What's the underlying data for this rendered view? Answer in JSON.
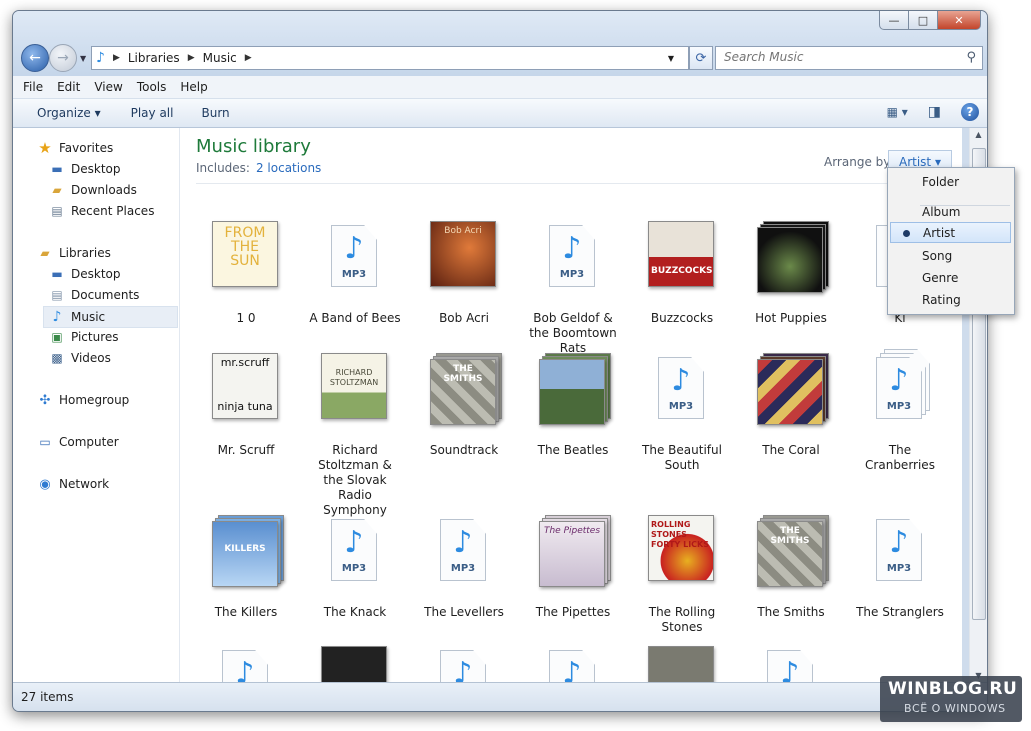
{
  "window": {
    "caption": {
      "minimize": "—",
      "maximize": "□",
      "close": "✕"
    }
  },
  "nav": {
    "back": "←",
    "forward": "→",
    "address": {
      "segments": [
        "Libraries",
        "Music"
      ]
    },
    "search": {
      "placeholder": "Search Music"
    }
  },
  "menu": [
    "File",
    "Edit",
    "View",
    "Tools",
    "Help"
  ],
  "toolbar": {
    "organize": "Organize ▾",
    "play_all": "Play all",
    "burn": "Burn",
    "help": "?"
  },
  "sidebar": {
    "favorites": {
      "label": "Favorites",
      "items": [
        "Desktop",
        "Downloads",
        "Recent Places"
      ]
    },
    "libraries": {
      "label": "Libraries",
      "items": [
        "Desktop",
        "Documents",
        "Music",
        "Pictures",
        "Videos"
      ],
      "selected": "Music"
    },
    "homegroup": "Homegroup",
    "computer": "Computer",
    "network": "Network"
  },
  "library": {
    "title": "Music library",
    "includes_label": "Includes:",
    "includes_link": "2 locations",
    "arrange_label": "Arrange by:",
    "arrange_value": "Artist ▾"
  },
  "arrange_menu": {
    "items": [
      "Folder",
      "Album",
      "Artist",
      "Song",
      "Genre",
      "Rating"
    ],
    "selected": "Artist"
  },
  "artists": [
    {
      "name": "1 0",
      "art": "cover"
    },
    {
      "name": "A Band of Bees",
      "art": "mp3"
    },
    {
      "name": "Bob Acri",
      "art": "cover"
    },
    {
      "name": "Bob Geldof & the Boomtown Rats",
      "art": "mp3"
    },
    {
      "name": "Buzzcocks",
      "art": "cover"
    },
    {
      "name": "Hot Puppies",
      "art": "cover-stack"
    },
    {
      "name": "Kl",
      "art": "mp3"
    },
    {
      "name": "Mr. Scruff",
      "art": "cover"
    },
    {
      "name": "Richard Stoltzman & the Slovak Radio Symphony Orc...",
      "art": "cover"
    },
    {
      "name": "Soundtrack",
      "art": "cover-stack"
    },
    {
      "name": "The Beatles",
      "art": "cover-stack"
    },
    {
      "name": "The Beautiful South",
      "art": "mp3"
    },
    {
      "name": "The Coral",
      "art": "cover-stack"
    },
    {
      "name": "The Cranberries",
      "art": "mp3-stack"
    },
    {
      "name": "The Killers",
      "art": "cover-stack"
    },
    {
      "name": "The Knack",
      "art": "mp3"
    },
    {
      "name": "The Levellers",
      "art": "mp3"
    },
    {
      "name": "The Pipettes",
      "art": "cover-stack"
    },
    {
      "name": "The Rolling Stones",
      "art": "cover"
    },
    {
      "name": "The Smiths",
      "art": "cover-stack"
    },
    {
      "name": "The Stranglers",
      "art": "mp3"
    }
  ],
  "album_text": {
    "from_the_sun": "FROM THE SUN",
    "bob_acri": "Bob Acri",
    "buzzcocks": "BUZZCOCKS",
    "mr_scruff_top": "mr.scruff",
    "mr_scruff_bottom": "ninja tuna",
    "stoltzman": "RICHARD STOLTZMAN",
    "smiths": "THE SMITHS",
    "killers": "KILLERS",
    "pipettes": "The Pipettes",
    "rolling": "ROLLING STONES FORTY LICKS",
    "mp3": "MP3",
    "note": "♪"
  },
  "status": {
    "count": "27 items"
  },
  "watermark": {
    "line1": "WINBLOG.RU",
    "line2": "ВСЁ О WINDOWS"
  }
}
